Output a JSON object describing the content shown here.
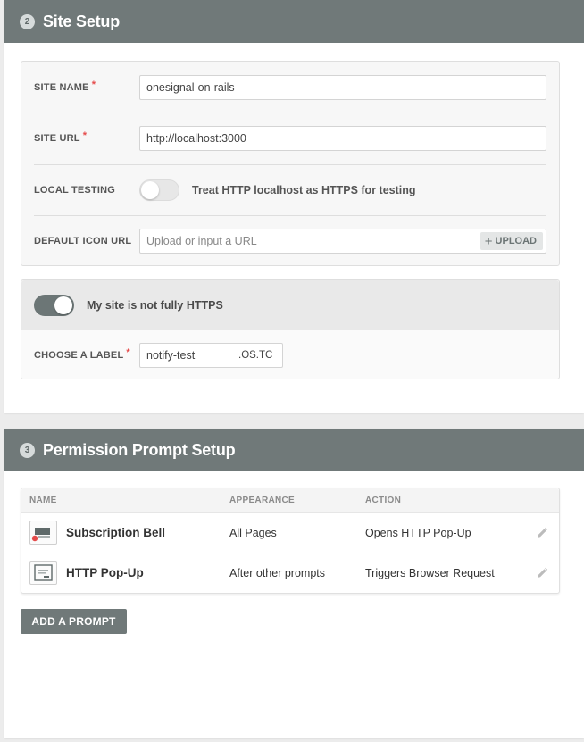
{
  "site_setup": {
    "step": "2",
    "title": "Site Setup",
    "site_name": {
      "label": "SITE NAME",
      "required_mark": "*",
      "value": "onesignal-on-rails"
    },
    "site_url": {
      "label": "SITE URL",
      "required_mark": "*",
      "value": "http://localhost:3000"
    },
    "local_testing": {
      "label": "LOCAL TESTING",
      "toggle_on": false,
      "toggle_text": "Treat HTTP localhost as HTTPS for testing"
    },
    "default_icon": {
      "label": "DEFAULT ICON URL",
      "placeholder": "Upload or input a URL",
      "upload_icon": "+",
      "upload_label": "UPLOAD"
    },
    "https": {
      "toggle_on": true,
      "toggle_text": "My site is not fully HTTPS",
      "label_field": {
        "label": "CHOOSE A LABEL",
        "required_mark": "*",
        "value": "notify-test",
        "suffix": ".OS.TC"
      }
    }
  },
  "prompt_setup": {
    "step": "3",
    "title": "Permission Prompt Setup",
    "columns": {
      "name": "NAME",
      "appearance": "APPEARANCE",
      "action": "ACTION"
    },
    "rows": [
      {
        "icon": "bell-prompt-icon",
        "name": "Subscription Bell",
        "appearance": "All Pages",
        "action": "Opens HTTP Pop-Up"
      },
      {
        "icon": "popup-prompt-icon",
        "name": "HTTP Pop-Up",
        "appearance": "After other prompts",
        "action": "Triggers Browser Request"
      }
    ],
    "add_button": "ADD A PROMPT"
  }
}
